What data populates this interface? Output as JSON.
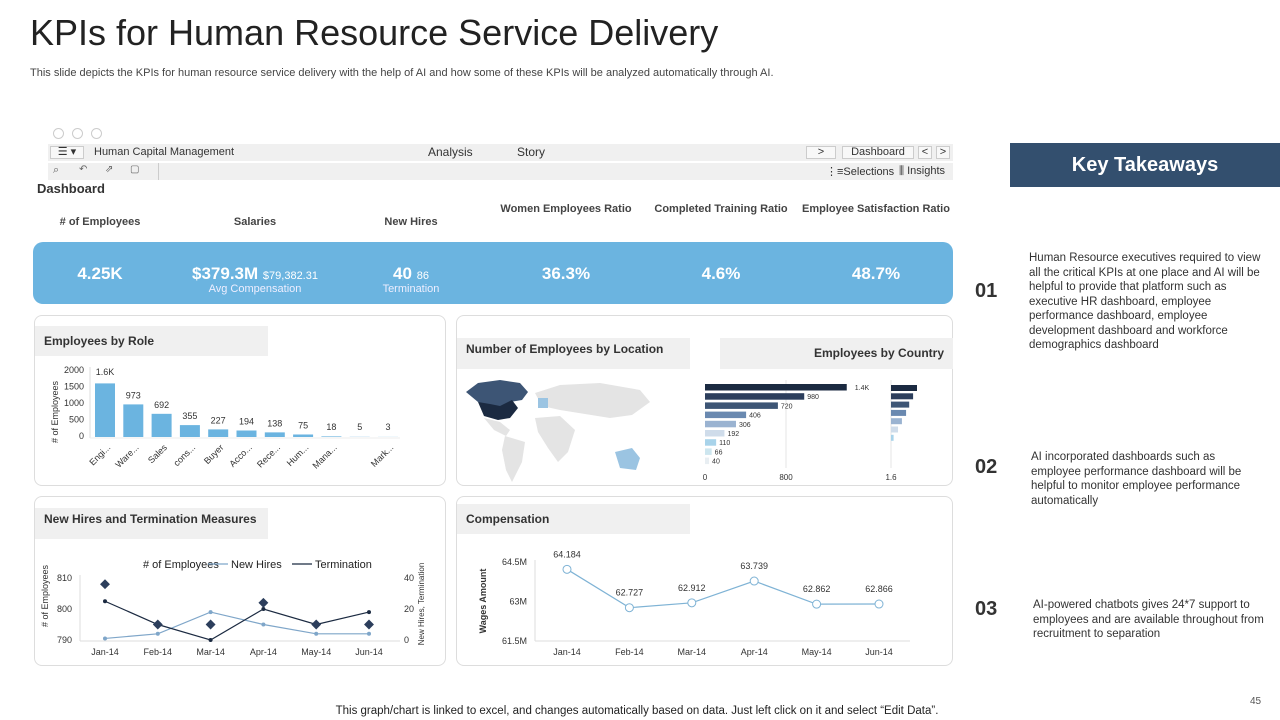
{
  "title": "KPIs for Human Resource Service Delivery",
  "subtitle": "This slide depicts the KPIs for human resource service delivery with the help of AI  and how some of these KPIs will be analyzed automatically through AI.",
  "app": {
    "name": "Human Capital Management",
    "tabs": [
      "Analysis",
      "Story"
    ],
    "nav_next": ">",
    "sheet": "Dashboard",
    "nav_prev": "<",
    "nav_fwd": ">",
    "selections": "Selections",
    "insights": "Insights",
    "section": "Dashboard"
  },
  "kpis": [
    {
      "label": "# of Employees",
      "value": "4.25K"
    },
    {
      "label": "Salaries",
      "value": "$379.3M",
      "sub": "$79,382.31",
      "caption": "Avg Compensation"
    },
    {
      "label": "New Hires",
      "value": "40",
      "sub": "86",
      "caption": "Termination"
    },
    {
      "label": "Women Employees Ratio",
      "value": "36.3%"
    },
    {
      "label": "Completed Training Ratio",
      "value": "4.6%"
    },
    {
      "label": "Employee Satisfaction Ratio",
      "value": "48.7%"
    }
  ],
  "chart_data": [
    {
      "id": "role",
      "type": "bar",
      "title": "Employees by Role",
      "ylabel": "# of Employees",
      "ylim": [
        0,
        2000
      ],
      "yticks": [
        "2000",
        "1500",
        "1000",
        "500",
        "0"
      ],
      "categories": [
        "Engi...",
        "Ware...",
        "Sales",
        "cons...",
        "Buyer",
        "Acco...",
        "Rece...",
        "Hum...",
        "Mana...",
        "",
        "Mark..."
      ],
      "values": [
        1600,
        973,
        692,
        355,
        227,
        194,
        138,
        75,
        18,
        5,
        3
      ],
      "labels": [
        "1.6K",
        "973",
        "692",
        "355",
        "227",
        "194",
        "138",
        "75",
        "18",
        "5",
        "3"
      ],
      "color": "#6bb4e0"
    },
    {
      "id": "country",
      "type": "bar",
      "orientation": "horizontal",
      "title": "Employees by Country",
      "values": [
        1400,
        980,
        720,
        406,
        306,
        192,
        110,
        66,
        40
      ],
      "labels": [
        "1.4K",
        "980",
        "720",
        "406",
        "306",
        "192",
        "110",
        "66",
        "40"
      ],
      "xlim": [
        0,
        1500
      ],
      "xticks": [
        "0",
        "800"
      ],
      "colors": [
        "#1b2a41",
        "#2c3e5c",
        "#3d5575",
        "#6a89b0",
        "#9ab3d1",
        "#cfdcea",
        "#a8d3ea",
        "#cde6ef",
        "#e8eef2"
      ],
      "secondary": {
        "tick": "1.6",
        "relative": [
          1,
          0.85,
          0.7,
          0.58,
          0.42,
          0.27,
          0.1
        ]
      }
    },
    {
      "id": "location",
      "type": "map",
      "title": "Number of Employees by Location"
    },
    {
      "id": "hires",
      "type": "line",
      "title": "New Hires and Termination Measures",
      "ylabel": "# of Employees",
      "y2label": "New Hires, Termination",
      "x": [
        "Jan-14",
        "Feb-14",
        "Mar-14",
        "Apr-14",
        "May-14",
        "Jun-14"
      ],
      "ylim": [
        790,
        810
      ],
      "y2lim": [
        0,
        40
      ],
      "yticks": [
        "810",
        "800",
        "790"
      ],
      "y2ticks": [
        "40",
        "20",
        "0"
      ],
      "series": [
        {
          "name": "# of Employees",
          "axis": "left",
          "values": [
            808,
            795,
            795,
            802,
            795,
            795
          ],
          "color": "#2c3e5c"
        },
        {
          "name": "New Hires",
          "axis": "right",
          "values": [
            1,
            4,
            18,
            10,
            4,
            4
          ],
          "color": "#7fa6c9"
        },
        {
          "name": "Termination",
          "axis": "right",
          "values": [
            25,
            10,
            0,
            20,
            10,
            18
          ],
          "color": "#1b2a41"
        }
      ]
    },
    {
      "id": "comp",
      "type": "line",
      "title": "Compensation",
      "ylabel": "Wages Amount",
      "ylim": [
        61.5,
        64.5
      ],
      "yticks": [
        "64.5M",
        "63M",
        "61.5M"
      ],
      "x": [
        "Jan-14",
        "Feb-14",
        "Mar-14",
        "Apr-14",
        "May-14",
        "Jun-14"
      ],
      "values": [
        64.184,
        62.727,
        62.912,
        63.739,
        62.862,
        62.866
      ],
      "labels": [
        "64.184",
        "62.727",
        "62.912",
        "63.739",
        "62.862",
        "62.866"
      ],
      "color": "#7fb3d5"
    }
  ],
  "takeaways": {
    "title": "Key Takeaways",
    "items": [
      {
        "num": "01",
        "text": "Human Resource executives required to view all the critical KPIs at one place and AI will be helpful to provide that platform such as executive HR dashboard, employee performance dashboard, employee development dashboard and workforce demographics dashboard"
      },
      {
        "num": "02",
        "text": "AI  incorporated dashboards such as employee performance dashboard  will be helpful to monitor employee performance automatically"
      },
      {
        "num": "03",
        "text": "AI-powered chatbots gives 24*7 support to employees and are available throughout from recruitment to separation"
      }
    ]
  },
  "footer": "This graph/chart is linked to excel,  and changes automatically based on data. Just left click on it and select “Edit Data”.",
  "page": "45"
}
